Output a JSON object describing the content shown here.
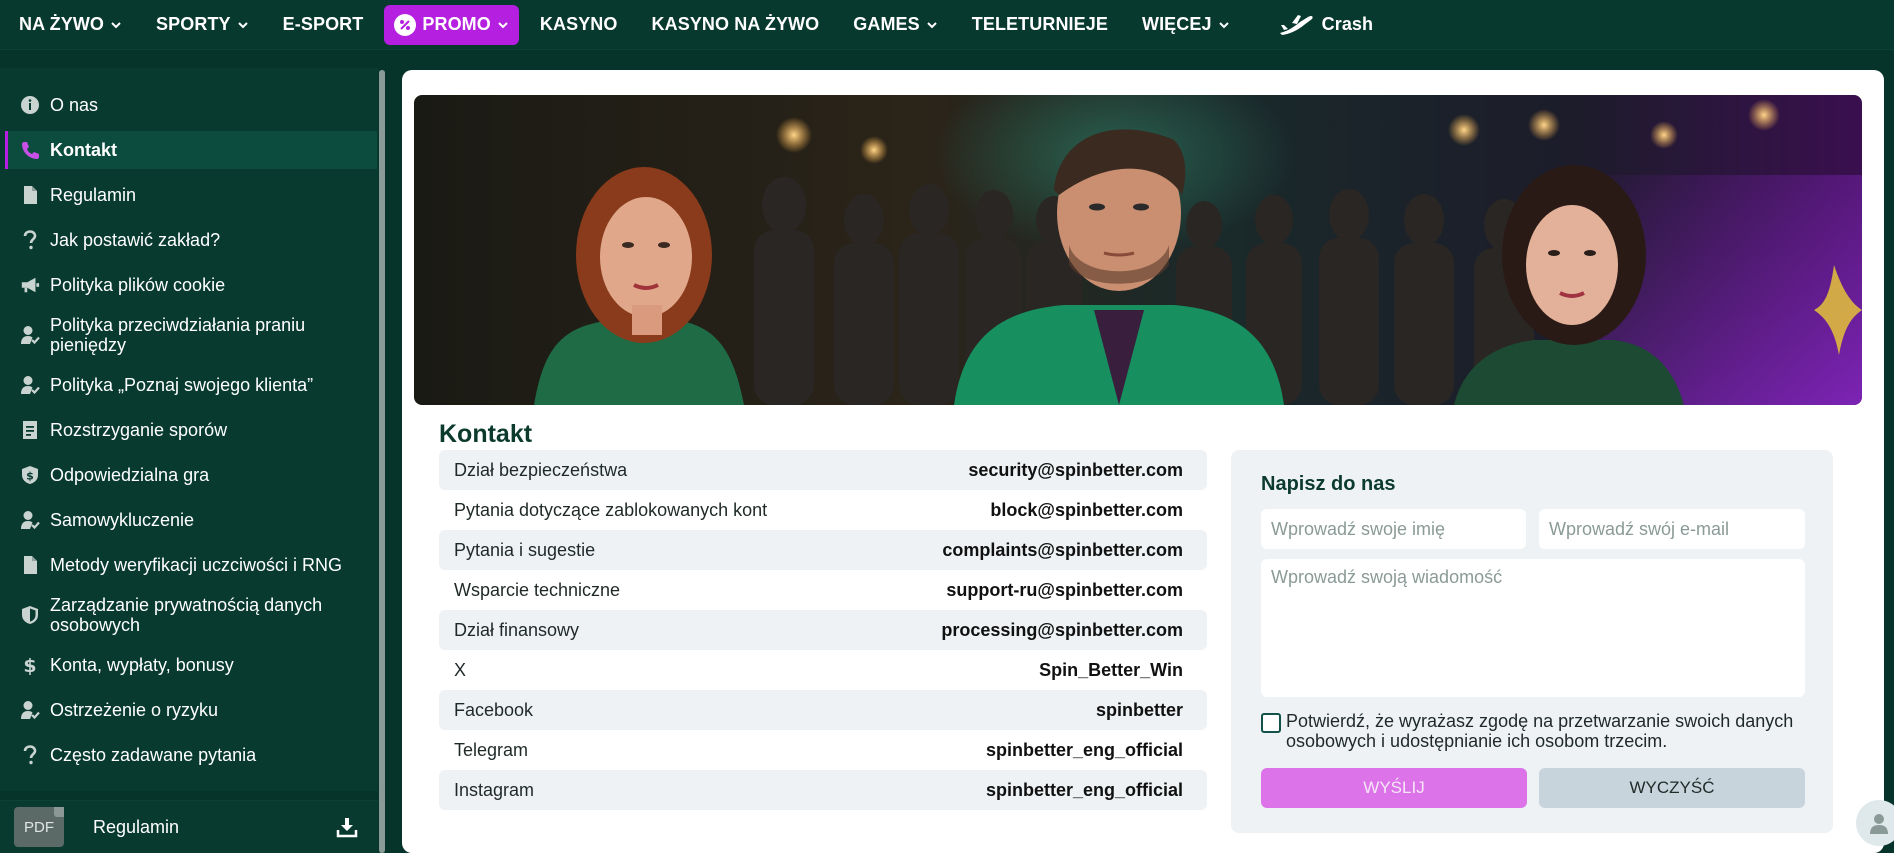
{
  "nav": {
    "items": [
      {
        "label": "NA ŻYWO",
        "dropdown": true
      },
      {
        "label": "SPORTY",
        "dropdown": true
      },
      {
        "label": "E-SPORT",
        "dropdown": false
      },
      {
        "label": "PROMO",
        "dropdown": true,
        "highlight": true
      },
      {
        "label": "KASYNO",
        "dropdown": false
      },
      {
        "label": "KASYNO NA ŻYWO",
        "dropdown": false
      },
      {
        "label": "GAMES",
        "dropdown": true
      },
      {
        "label": "TELETURNIEJE",
        "dropdown": false
      },
      {
        "label": "WIĘCEJ",
        "dropdown": true
      },
      {
        "label": "Crash",
        "dropdown": false,
        "icon": "plane-icon"
      }
    ]
  },
  "sidebar": {
    "items": [
      {
        "label": "O nas",
        "icon": "info-icon"
      },
      {
        "label": "Kontakt",
        "icon": "phone-icon",
        "active": true
      },
      {
        "label": "Regulamin",
        "icon": "document-icon"
      },
      {
        "label": "Jak postawić zakład?",
        "icon": "question-icon"
      },
      {
        "label": "Polityka plików cookie",
        "icon": "megaphone-icon"
      },
      {
        "label": "Polityka przeciwdziałania praniu pieniędzy",
        "icon": "user-check-icon"
      },
      {
        "label": "Polityka „Poznaj swojego klienta”",
        "icon": "user-check-icon"
      },
      {
        "label": "Rozstrzyganie sporów",
        "icon": "document-lines-icon"
      },
      {
        "label": "Odpowiedzialna gra",
        "icon": "shield-dollar-icon"
      },
      {
        "label": "Samowykluczenie",
        "icon": "user-check-icon"
      },
      {
        "label": "Metody weryfikacji uczciwości i RNG",
        "icon": "document-icon"
      },
      {
        "label": "Zarządzanie prywatnością danych osobowych",
        "icon": "shield-icon"
      },
      {
        "label": "Konta, wypłaty, bonusy",
        "icon": "dollar-icon"
      },
      {
        "label": "Ostrzeżenie o ryzyku",
        "icon": "user-check-icon"
      },
      {
        "label": "Często zadawane pytania",
        "icon": "question-icon"
      }
    ],
    "footer": {
      "pdf_label": "PDF",
      "label": "Regulamin"
    }
  },
  "main": {
    "title": "Kontakt",
    "contacts": [
      {
        "label": "Dział bezpieczeństwa",
        "value": "security@spinbetter.com"
      },
      {
        "label": "Pytania dotyczące zablokowanych kont",
        "value": "block@spinbetter.com"
      },
      {
        "label": "Pytania i sugestie",
        "value": "complaints@spinbetter.com"
      },
      {
        "label": "Wsparcie techniczne",
        "value": "support-ru@spinbetter.com"
      },
      {
        "label": "Dział finansowy",
        "value": "processing@spinbetter.com"
      },
      {
        "label": "X",
        "value": "Spin_Better_Win"
      },
      {
        "label": "Facebook",
        "value": "spinbetter"
      },
      {
        "label": "Telegram",
        "value": "spinbetter_eng_official"
      },
      {
        "label": "Instagram",
        "value": "spinbetter_eng_official"
      }
    ],
    "form": {
      "title": "Napisz do nas",
      "name_placeholder": "Wprowadź swoje imię",
      "email_placeholder": "Wprowadź swój e-mail",
      "message_placeholder": "Wprowadź swoją wiadomość",
      "consent": "Potwierdź, że wyrażasz zgodę na przetwarzanie swoich danych osobowych i udostępnianie ich osobom trzecim.",
      "send_label": "WYŚLIJ",
      "clear_label": "WYCZYŚĆ"
    }
  },
  "colors": {
    "background": "#06332a",
    "accent": "#b41fe0",
    "send_button": "#dc73e8"
  }
}
